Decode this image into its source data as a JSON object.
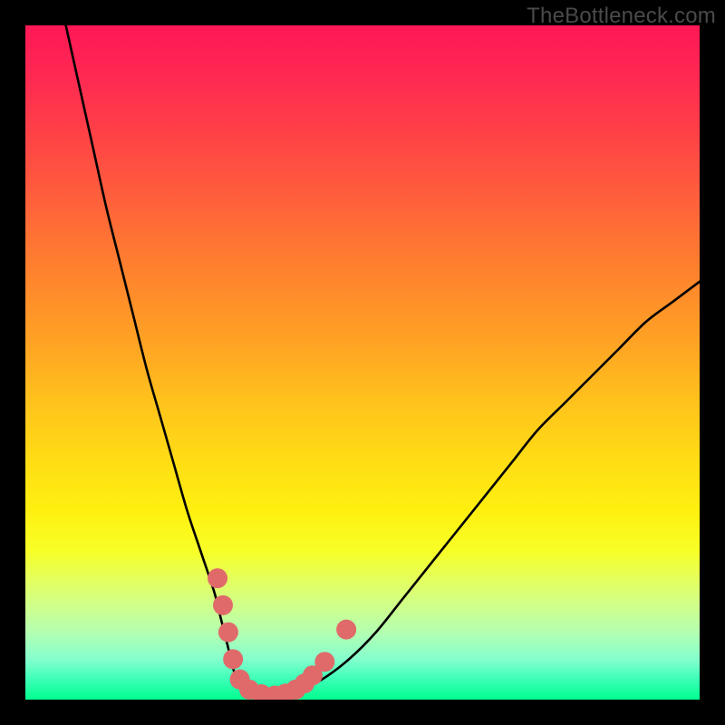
{
  "attribution": "TheBottleneck.com",
  "colors": {
    "frame": "#000000",
    "gradient_top": "#ff1756",
    "gradient_mid": "#ffd015",
    "gradient_bottom": "#00ff8f",
    "curve": "#000000",
    "marker": "#e06a6a"
  },
  "chart_data": {
    "type": "line",
    "title": "",
    "xlabel": "",
    "ylabel": "",
    "xlim": [
      0,
      100
    ],
    "ylim": [
      0,
      100
    ],
    "series": [
      {
        "name": "curve",
        "x": [
          6,
          8,
          10,
          12,
          14,
          16,
          18,
          20,
          22,
          24,
          26,
          28,
          29,
          30,
          31,
          32,
          34,
          36,
          38,
          40,
          44,
          48,
          52,
          56,
          60,
          64,
          68,
          72,
          76,
          80,
          84,
          88,
          92,
          96,
          100
        ],
        "values": [
          100,
          91,
          82,
          73,
          65,
          57,
          49,
          42,
          35,
          28,
          22,
          16,
          12,
          8,
          4,
          2,
          1,
          0.5,
          0.5,
          1,
          3,
          6,
          10,
          15,
          20,
          25,
          30,
          35,
          40,
          44,
          48,
          52,
          56,
          59,
          62
        ]
      }
    ],
    "markers": [
      {
        "x": 28.5,
        "y": 18
      },
      {
        "x": 29.3,
        "y": 14
      },
      {
        "x": 30.1,
        "y": 10
      },
      {
        "x": 30.8,
        "y": 6
      },
      {
        "x": 31.8,
        "y": 3
      },
      {
        "x": 33.2,
        "y": 1.5
      },
      {
        "x": 35.0,
        "y": 0.8
      },
      {
        "x": 37.0,
        "y": 0.6
      },
      {
        "x": 38.6,
        "y": 0.9
      },
      {
        "x": 40.1,
        "y": 1.5
      },
      {
        "x": 41.4,
        "y": 2.4
      },
      {
        "x": 42.6,
        "y": 3.6
      },
      {
        "x": 44.4,
        "y": 5.6
      },
      {
        "x": 47.6,
        "y": 10.4
      }
    ]
  }
}
